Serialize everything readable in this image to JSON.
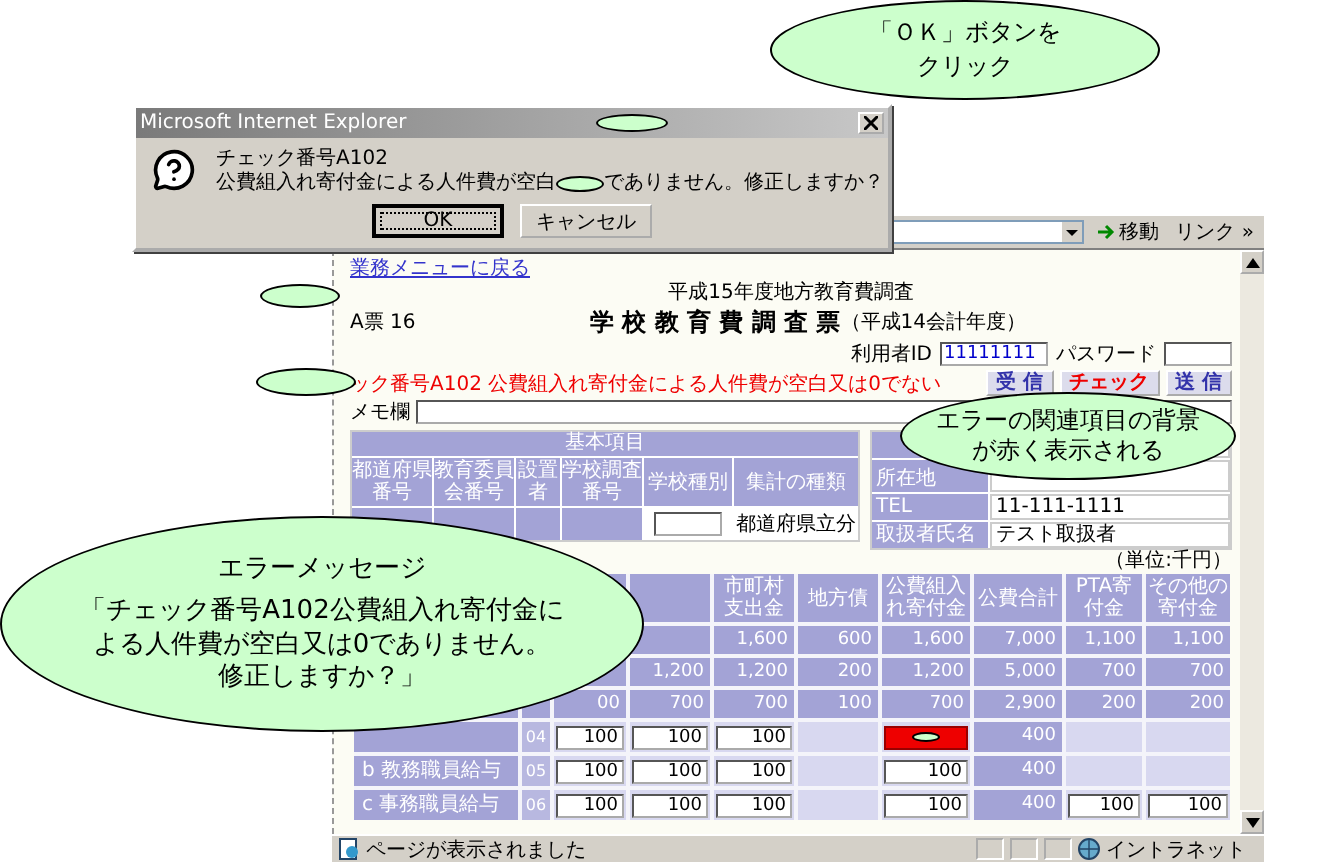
{
  "callouts": [
    {
      "kind": "note",
      "lines": [
        "「ＯＫ」ボタンを",
        "クリック"
      ]
    },
    {
      "kind": "note",
      "lines": [
        "エラーの関連項目の背景",
        "が赤く表示される"
      ]
    },
    {
      "kind": "message",
      "title": "エラーメッセージ",
      "lines": [
        "「チェック番号A102公費組入れ寄付金に",
        "よる人件費が空白又は0でありません。",
        "修正しますか？」"
      ]
    }
  ],
  "dialog": {
    "title": "Microsoft Internet Explorer",
    "heading": "チェック番号A102",
    "message_before": "公費組入れ寄付金による人件費が空白",
    "message_after": "でありません。修正しますか？",
    "buttons": [
      {
        "label": "OK",
        "selected": true
      },
      {
        "label": "キャンセル",
        "selected": false
      }
    ]
  },
  "browser": {
    "toolbar": {
      "go": "移動",
      "links": "リンク »"
    },
    "page": {
      "back_link": "業務メニューに戻る",
      "survey": "平成15年度地方教育費調査",
      "form_code": "A票 16",
      "title": "学 校 教 育 費 調 査 票",
      "title_year": "（平成14会計年度）",
      "login": {
        "user_label": "利用者ID",
        "user_value": "11111111",
        "password_label": "パスワード"
      },
      "error": "ック番号A102 公費組入れ寄付金による人件費が空白又は0でない",
      "actions": [
        {
          "label": "受 信",
          "kind": "normal"
        },
        {
          "label": "チェック",
          "kind": "alert"
        },
        {
          "label": "送 信",
          "kind": "normal"
        }
      ],
      "memo_label": "メモ欄",
      "basic": {
        "title": "基本項目",
        "columns": [
          "都道府県番号",
          "教育委員会番号",
          "設置者",
          "学校調査番号",
          "学校種別",
          "集計の種類"
        ],
        "tally_value": "都道府県立分"
      },
      "contact": [
        {
          "label": "所在地"
        },
        {
          "label": "TEL",
          "value": "11-111-1111"
        },
        {
          "label": "取扱者氏名",
          "value": "テスト取扱者"
        }
      ],
      "unit": "（単位:千円）",
      "money": {
        "columns": [
          "市町村支出金",
          "地方債",
          "公費組入れ寄付金",
          "公費合計",
          "PTA寄付金",
          "その他の寄付金"
        ],
        "total_rows": [
          [
            "1,600",
            "600",
            "1,600",
            "7,000",
            "1,100",
            "1,100"
          ],
          [
            "1,200",
            "1,200",
            "200",
            "1,200",
            "5,000",
            "700",
            "700"
          ],
          [
            "00",
            "700",
            "700",
            "100",
            "700",
            "2,900",
            "200",
            "200"
          ]
        ],
        "input_rows": [
          {
            "code": "04",
            "cells": [
              {
                "kind": "input",
                "value": "100"
              },
              {
                "kind": "input",
                "value": "100"
              },
              {
                "kind": "input",
                "value": "100"
              },
              {
                "kind": "blank"
              },
              {
                "kind": "error"
              },
              {
                "kind": "value",
                "value": "400"
              },
              {
                "kind": "blank"
              },
              {
                "kind": "blank"
              }
            ]
          },
          {
            "label": "b 教務職員給与",
            "code": "05",
            "cells": [
              {
                "kind": "input",
                "value": "100"
              },
              {
                "kind": "input",
                "value": "100"
              },
              {
                "kind": "input",
                "value": "100"
              },
              {
                "kind": "blank"
              },
              {
                "kind": "input",
                "value": "100"
              },
              {
                "kind": "value",
                "value": "400"
              },
              {
                "kind": "blank"
              },
              {
                "kind": "blank"
              }
            ]
          },
          {
            "label": "c 事務職員給与",
            "code": "06",
            "cells": [
              {
                "kind": "input",
                "value": "100"
              },
              {
                "kind": "input",
                "value": "100"
              },
              {
                "kind": "input",
                "value": "100"
              },
              {
                "kind": "blank"
              },
              {
                "kind": "input",
                "value": "100"
              },
              {
                "kind": "value",
                "value": "400"
              },
              {
                "kind": "input",
                "value": "100"
              },
              {
                "kind": "input",
                "value": "100"
              }
            ]
          }
        ]
      }
    },
    "status_bar": {
      "text": "ページが表示されました",
      "zone": "イントラネット"
    }
  }
}
